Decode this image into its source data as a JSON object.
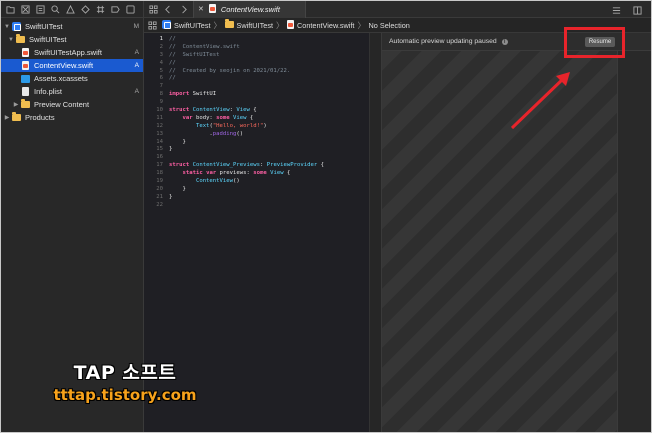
{
  "navigator": {
    "toolbar_icons": [
      "folder-icon",
      "source-control-icon",
      "hierarchy-icon",
      "find-icon",
      "issue-icon",
      "test-icon",
      "debug-icon",
      "breakpoint-icon",
      "report-icon"
    ],
    "items": [
      {
        "label": "SwiftUITest",
        "status": "M",
        "icon": "project-icon",
        "level": 0,
        "disclosure": "open"
      },
      {
        "label": "SwiftUITest",
        "status": "",
        "icon": "folder-icon",
        "level": 1,
        "disclosure": "open"
      },
      {
        "label": "SwiftUITestApp.swift",
        "status": "A",
        "icon": "swift-file-icon",
        "level": 2,
        "disclosure": ""
      },
      {
        "label": "ContentView.swift",
        "status": "A",
        "icon": "swift-file-icon",
        "level": 2,
        "disclosure": "",
        "selected": true
      },
      {
        "label": "Assets.xcassets",
        "status": "",
        "icon": "assets-icon",
        "level": 2,
        "disclosure": ""
      },
      {
        "label": "Info.plist",
        "status": "A",
        "icon": "plist-icon",
        "level": 2,
        "disclosure": ""
      },
      {
        "label": "Preview Content",
        "status": "",
        "icon": "folder-icon",
        "level": 2,
        "disclosure": "closed"
      },
      {
        "label": "Products",
        "status": "",
        "icon": "folder-icon",
        "level": 1,
        "disclosure": "closed"
      }
    ]
  },
  "tabbar": {
    "active_tab": "ContentView.swift"
  },
  "jumpbar": {
    "crumbs": [
      "SwiftUITest",
      "SwiftUITest",
      "ContentView.swift",
      "No Selection"
    ]
  },
  "editor": {
    "line_numbers": [
      "1",
      "2",
      "3",
      "4",
      "5",
      "6",
      "7",
      "8",
      "9",
      "10",
      "11",
      "12",
      "13",
      "14",
      "15",
      "16",
      "17",
      "18",
      "19",
      "20",
      "21",
      "22"
    ],
    "lines": [
      "//",
      "//  ContentView.swift",
      "//  SwiftUITest",
      "//",
      "//  Created by seojin on 2021/01/22.",
      "//",
      "",
      "import SwiftUI",
      "",
      "struct ContentView: View {",
      "    var body: some View {",
      "        Text(\"Hello, world!\")",
      "            .padding()",
      "    }",
      "}",
      "",
      "struct ContentView_Previews: PreviewProvider {",
      "    static var previews: some View {",
      "        ContentView()",
      "    }",
      "}",
      ""
    ]
  },
  "preview": {
    "message": "Automatic preview updating paused",
    "info_icon": "info-icon",
    "resume_label": "Resume"
  },
  "annotation": {
    "highlight_color": "#e8242b",
    "arrow_color": "#e8242b"
  },
  "watermark": {
    "title": "TAP 소프트",
    "url": "tttap.tistory.com",
    "title_color": "#ffffff",
    "url_color": "#f7a21b"
  },
  "colors": {
    "selection": "#1a5ad0",
    "keyword": "#fc5fa3",
    "type": "#5dd8ff",
    "string": "#fc6a5d",
    "comment": "#7f8c98"
  }
}
